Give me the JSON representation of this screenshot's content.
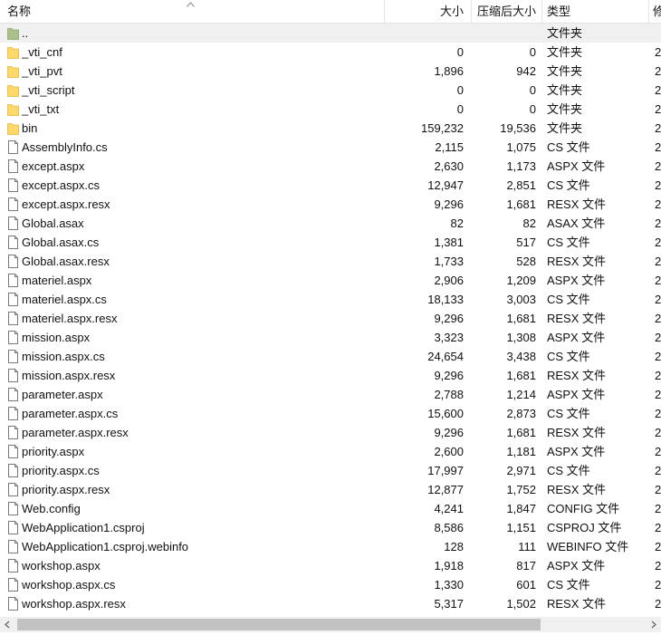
{
  "columns": {
    "name": "名称",
    "size": "大小",
    "compressed": "压缩后大小",
    "type": "类型",
    "extra": "修"
  },
  "files": [
    {
      "name": "..",
      "size": "",
      "compressed": "",
      "type": "文件夹",
      "icon": "parent-folder-icon",
      "extra": ""
    },
    {
      "name": "_vti_cnf",
      "size": "0",
      "compressed": "0",
      "type": "文件夹",
      "icon": "folder-icon",
      "extra": "2"
    },
    {
      "name": "_vti_pvt",
      "size": "1,896",
      "compressed": "942",
      "type": "文件夹",
      "icon": "folder-icon",
      "extra": "2"
    },
    {
      "name": "_vti_script",
      "size": "0",
      "compressed": "0",
      "type": "文件夹",
      "icon": "folder-icon",
      "extra": "2"
    },
    {
      "name": "_vti_txt",
      "size": "0",
      "compressed": "0",
      "type": "文件夹",
      "icon": "folder-icon",
      "extra": "2"
    },
    {
      "name": "bin",
      "size": "159,232",
      "compressed": "19,536",
      "type": "文件夹",
      "icon": "folder-icon",
      "extra": "2"
    },
    {
      "name": "AssemblyInfo.cs",
      "size": "2,115",
      "compressed": "1,075",
      "type": "CS 文件",
      "icon": "file-icon",
      "extra": "2"
    },
    {
      "name": "except.aspx",
      "size": "2,630",
      "compressed": "1,173",
      "type": "ASPX 文件",
      "icon": "file-icon",
      "extra": "2"
    },
    {
      "name": "except.aspx.cs",
      "size": "12,947",
      "compressed": "2,851",
      "type": "CS 文件",
      "icon": "file-icon",
      "extra": "2"
    },
    {
      "name": "except.aspx.resx",
      "size": "9,296",
      "compressed": "1,681",
      "type": "RESX 文件",
      "icon": "file-icon",
      "extra": "2"
    },
    {
      "name": "Global.asax",
      "size": "82",
      "compressed": "82",
      "type": "ASAX 文件",
      "icon": "file-icon",
      "extra": "2"
    },
    {
      "name": "Global.asax.cs",
      "size": "1,381",
      "compressed": "517",
      "type": "CS 文件",
      "icon": "file-icon",
      "extra": "2"
    },
    {
      "name": "Global.asax.resx",
      "size": "1,733",
      "compressed": "528",
      "type": "RESX 文件",
      "icon": "file-icon",
      "extra": "2"
    },
    {
      "name": "materiel.aspx",
      "size": "2,906",
      "compressed": "1,209",
      "type": "ASPX 文件",
      "icon": "file-icon",
      "extra": "2"
    },
    {
      "name": "materiel.aspx.cs",
      "size": "18,133",
      "compressed": "3,003",
      "type": "CS 文件",
      "icon": "file-icon",
      "extra": "2"
    },
    {
      "name": "materiel.aspx.resx",
      "size": "9,296",
      "compressed": "1,681",
      "type": "RESX 文件",
      "icon": "file-icon",
      "extra": "2"
    },
    {
      "name": "mission.aspx",
      "size": "3,323",
      "compressed": "1,308",
      "type": "ASPX 文件",
      "icon": "file-icon",
      "extra": "2"
    },
    {
      "name": "mission.aspx.cs",
      "size": "24,654",
      "compressed": "3,438",
      "type": "CS 文件",
      "icon": "file-icon",
      "extra": "2"
    },
    {
      "name": "mission.aspx.resx",
      "size": "9,296",
      "compressed": "1,681",
      "type": "RESX 文件",
      "icon": "file-icon",
      "extra": "2"
    },
    {
      "name": "parameter.aspx",
      "size": "2,788",
      "compressed": "1,214",
      "type": "ASPX 文件",
      "icon": "file-icon",
      "extra": "2"
    },
    {
      "name": "parameter.aspx.cs",
      "size": "15,600",
      "compressed": "2,873",
      "type": "CS 文件",
      "icon": "file-icon",
      "extra": "2"
    },
    {
      "name": "parameter.aspx.resx",
      "size": "9,296",
      "compressed": "1,681",
      "type": "RESX 文件",
      "icon": "file-icon",
      "extra": "2"
    },
    {
      "name": "priority.aspx",
      "size": "2,600",
      "compressed": "1,181",
      "type": "ASPX 文件",
      "icon": "file-icon",
      "extra": "2"
    },
    {
      "name": "priority.aspx.cs",
      "size": "17,997",
      "compressed": "2,971",
      "type": "CS 文件",
      "icon": "file-icon",
      "extra": "2"
    },
    {
      "name": "priority.aspx.resx",
      "size": "12,877",
      "compressed": "1,752",
      "type": "RESX 文件",
      "icon": "file-icon",
      "extra": "2"
    },
    {
      "name": "Web.config",
      "size": "4,241",
      "compressed": "1,847",
      "type": "CONFIG 文件",
      "icon": "file-icon",
      "extra": "2"
    },
    {
      "name": "WebApplication1.csproj",
      "size": "8,586",
      "compressed": "1,151",
      "type": "CSPROJ 文件",
      "icon": "file-icon",
      "extra": "2"
    },
    {
      "name": "WebApplication1.csproj.webinfo",
      "size": "128",
      "compressed": "111",
      "type": "WEBINFO 文件",
      "icon": "file-icon",
      "extra": "2"
    },
    {
      "name": "workshop.aspx",
      "size": "1,918",
      "compressed": "817",
      "type": "ASPX 文件",
      "icon": "file-icon",
      "extra": "2"
    },
    {
      "name": "workshop.aspx.cs",
      "size": "1,330",
      "compressed": "601",
      "type": "CS 文件",
      "icon": "file-icon",
      "extra": "2"
    },
    {
      "name": "workshop.aspx.resx",
      "size": "5,317",
      "compressed": "1,502",
      "type": "RESX 文件",
      "icon": "file-icon",
      "extra": "2"
    }
  ],
  "colors": {
    "folder": "#ffd86b",
    "parent_folder": "#a9c08a",
    "parent_row_bg": "#f0f0f0",
    "scrollbar_thumb": "#c2c2c2"
  }
}
